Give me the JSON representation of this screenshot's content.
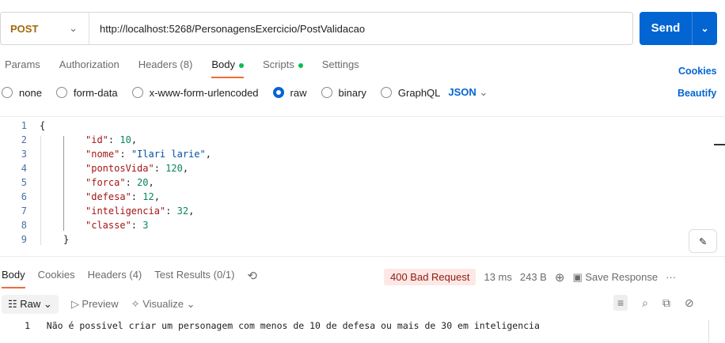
{
  "request": {
    "method": "POST",
    "url": "http://localhost:5268/PersonagensExercicio/PostValidacao",
    "send": "Send"
  },
  "tabs": [
    {
      "label": "Params"
    },
    {
      "label": "Authorization"
    },
    {
      "label": "Headers (8)"
    },
    {
      "label": "Body"
    },
    {
      "label": "Scripts"
    },
    {
      "label": "Settings"
    }
  ],
  "cookies": "Cookies",
  "beautify": "Beautify",
  "body_types": [
    "none",
    "form-data",
    "x-www-form-urlencoded",
    "raw",
    "binary",
    "GraphQL"
  ],
  "format": "JSON",
  "code": {
    "lines": [
      "1",
      "2",
      "3",
      "4",
      "5",
      "6",
      "7",
      "8",
      "9"
    ],
    "open": "{",
    "close": "}",
    "fields": [
      {
        "k": "\"id\"",
        "v": "10",
        "t": "n",
        "c": ","
      },
      {
        "k": "\"nome\"",
        "v": "\"Ilari larie\"",
        "t": "s",
        "c": ","
      },
      {
        "k": "\"pontosVida\"",
        "v": "120",
        "t": "n",
        "c": ","
      },
      {
        "k": "\"forca\"",
        "v": "20",
        "t": "n",
        "c": ","
      },
      {
        "k": "\"defesa\"",
        "v": "12",
        "t": "n",
        "c": ","
      },
      {
        "k": "\"inteligencia\"",
        "v": "32",
        "t": "n",
        "c": ","
      },
      {
        "k": "\"classe\"",
        "v": "3",
        "t": "n",
        "c": ""
      }
    ]
  },
  "response": {
    "tabs": [
      "Body",
      "Cookies",
      "Headers (4)",
      "Test Results (0/1)"
    ],
    "status": "400 Bad Request",
    "time": "13 ms",
    "size": "243 B",
    "save": "Save Response",
    "view": "Raw",
    "preview": "Preview",
    "visualize": "Visualize",
    "line": "1",
    "text": "Não é possivel criar um personagem com menos de 10 de defesa ou mais de 30 em inteligencia"
  }
}
